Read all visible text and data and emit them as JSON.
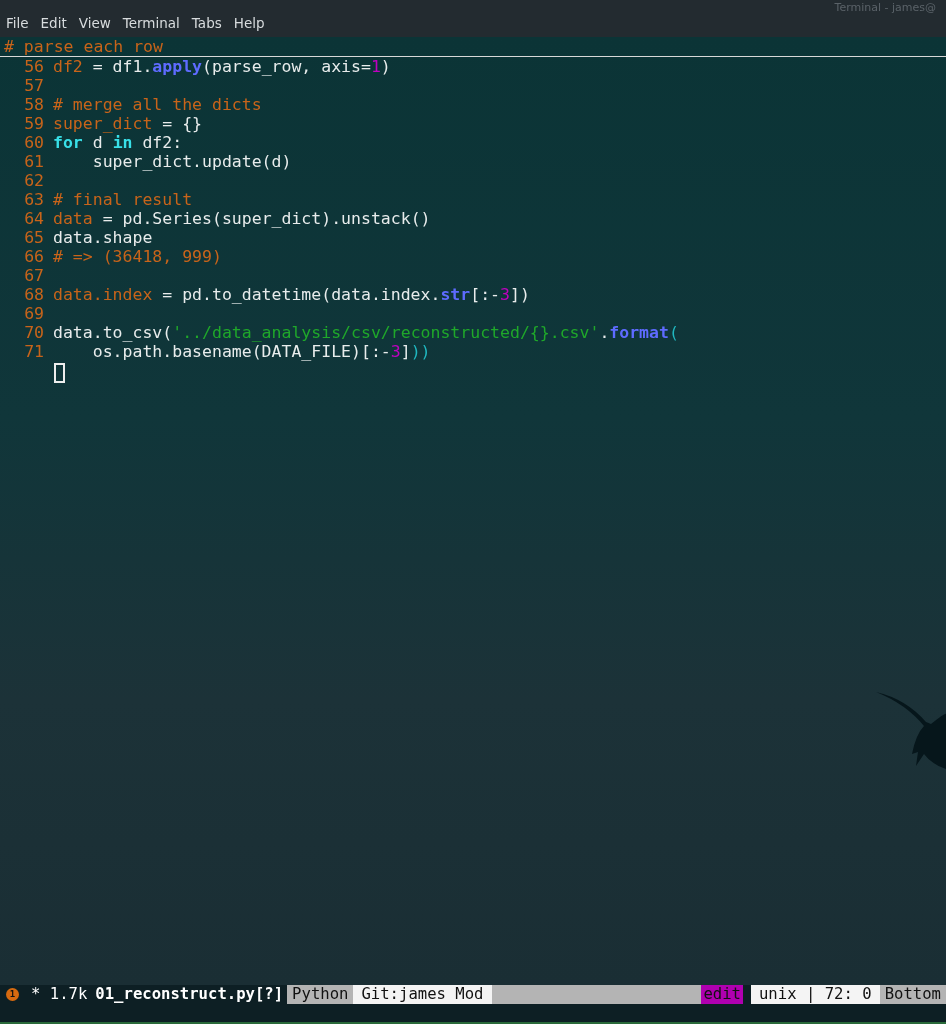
{
  "window": {
    "title": "Terminal - james@"
  },
  "menu": [
    "File",
    "Edit",
    "View",
    "Terminal",
    "Tabs",
    "Help"
  ],
  "editor": {
    "header": "# parse each row",
    "lines": [
      {
        "number": "56",
        "tokens": [
          {
            "text": "df2",
            "kind": "target"
          },
          {
            "text": " = df1.",
            "kind": "plain"
          },
          {
            "text": "apply",
            "kind": "func"
          },
          {
            "text": "(parse_row, axis=",
            "kind": "plain"
          },
          {
            "text": "1",
            "kind": "number"
          },
          {
            "text": ")",
            "kind": "plain"
          }
        ]
      },
      {
        "number": "57"
      },
      {
        "number": "58",
        "tokens": [
          {
            "text": "# merge all the dicts",
            "kind": "comment"
          }
        ]
      },
      {
        "number": "59",
        "tokens": [
          {
            "text": "super_dict",
            "kind": "target"
          },
          {
            "text": " = {}",
            "kind": "plain"
          }
        ]
      },
      {
        "number": "60",
        "tokens": [
          {
            "text": "for",
            "kind": "keyword"
          },
          {
            "text": " d ",
            "kind": "plain"
          },
          {
            "text": "in",
            "kind": "keyword"
          },
          {
            "text": " df2:",
            "kind": "plain"
          }
        ]
      },
      {
        "number": "61",
        "tokens": [
          {
            "text": "    super_dict.update(d)",
            "kind": "plain"
          }
        ]
      },
      {
        "number": "62"
      },
      {
        "number": "63",
        "tokens": [
          {
            "text": "# final result",
            "kind": "comment"
          }
        ]
      },
      {
        "number": "64",
        "tokens": [
          {
            "text": "data",
            "kind": "target"
          },
          {
            "text": " = pd.Series(super_dict).unstack()",
            "kind": "plain"
          }
        ]
      },
      {
        "number": "65",
        "tokens": [
          {
            "text": "data.shape",
            "kind": "plain"
          }
        ]
      },
      {
        "number": "66",
        "tokens": [
          {
            "text": "# => (36418, 999)",
            "kind": "comment"
          }
        ]
      },
      {
        "number": "67"
      },
      {
        "number": "68",
        "tokens": [
          {
            "text": "data.index",
            "kind": "target"
          },
          {
            "text": " = pd.to_datetime(data.index.",
            "kind": "plain"
          },
          {
            "text": "str",
            "kind": "func"
          },
          {
            "text": "[:-",
            "kind": "plain"
          },
          {
            "text": "3",
            "kind": "number"
          },
          {
            "text": "])",
            "kind": "plain"
          }
        ]
      },
      {
        "number": "69"
      },
      {
        "number": "70",
        "tokens": [
          {
            "text": "data.to_csv(",
            "kind": "plain"
          },
          {
            "text": "'../data_analysis/csv/reconstructed/{}.csv'",
            "kind": "string"
          },
          {
            "text": ".",
            "kind": "plain"
          },
          {
            "text": "format",
            "kind": "func"
          },
          {
            "text": "(",
            "kind": "paren"
          }
        ]
      },
      {
        "number": "71",
        "tokens": [
          {
            "text": "    os.path.basename(DATA_FILE)[:-",
            "kind": "plain"
          },
          {
            "text": "3",
            "kind": "number"
          },
          {
            "text": "]",
            "kind": "plain"
          },
          {
            "text": "))",
            "kind": "paren"
          }
        ]
      }
    ]
  },
  "status_bar": [
    {
      "kind": "badge",
      "text": "1"
    },
    {
      "kind": "info",
      "text": "* 1.7k"
    },
    {
      "kind": "file",
      "text": "01_reconstruct.py[?]"
    },
    {
      "kind": "gray",
      "text": "Python"
    },
    {
      "kind": "light",
      "text": "Git:james Mod"
    },
    {
      "kind": "filler"
    },
    {
      "kind": "mode",
      "text": "edit"
    },
    {
      "kind": "light",
      "text": "unix | 72: 0"
    },
    {
      "kind": "gray",
      "text": "Bottom"
    }
  ]
}
